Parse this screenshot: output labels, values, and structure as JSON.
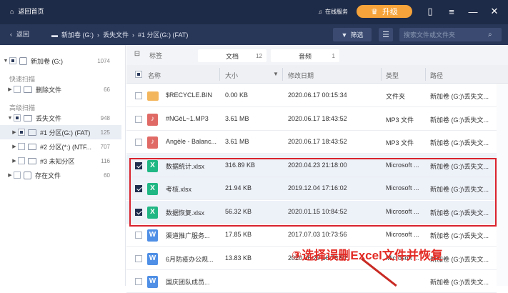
{
  "titlebar": {
    "home_label": "返回首页",
    "online_label": "在线服务",
    "upgrade_label": "升级"
  },
  "navbar": {
    "back_label": "返回",
    "breadcrumb": [
      "新加卷 (G:)",
      "丢失文件",
      "#1 分区(G:) (FAT)"
    ],
    "filter_label": "筛选",
    "search_placeholder": "搜索文件或文件夹"
  },
  "sidebar": {
    "root": {
      "label": "新加卷 (G:)",
      "count": "1074"
    },
    "quick_scan_label": "快速扫描",
    "deleted": {
      "label": "删除文件",
      "count": "66"
    },
    "adv_scan_label": "高级扫描",
    "lost": {
      "label": "丢失文件",
      "count": "948"
    },
    "partitions": [
      {
        "label": "#1 分区(G:) (FAT)",
        "count": "125"
      },
      {
        "label": "#2 分区(*:) (NTF...",
        "count": "707"
      },
      {
        "label": "#3 未知分区",
        "count": "116"
      }
    ],
    "existing": {
      "label": "存在文件",
      "count": "60"
    }
  },
  "tabs": {
    "tag_label": "标签",
    "items": [
      {
        "label": "文档",
        "count": "12"
      },
      {
        "label": "音频",
        "count": "1"
      }
    ]
  },
  "columns": {
    "name": "名称",
    "size": "大小",
    "date": "修改日期",
    "type": "类型",
    "path": "路径"
  },
  "rows": [
    {
      "icon": "folder",
      "name": "$RECYCLE.BIN",
      "size": "0.00 KB",
      "date": "2020.06.17 00:15:34",
      "type": "文件夹",
      "path": "新加卷 (G:)\\丢失文...",
      "checked": false
    },
    {
      "icon": "mp3",
      "name": "#NGèL~1.MP3",
      "size": "3.61 MB",
      "date": "2020.06.17 18:43:52",
      "type": "MP3 文件",
      "path": "新加卷 (G:)\\丢失文...",
      "checked": false
    },
    {
      "icon": "mp3",
      "name": "Angèle - Balanc...",
      "size": "3.61 MB",
      "date": "2020.06.17 18:43:52",
      "type": "MP3 文件",
      "path": "新加卷 (G:)\\丢失文...",
      "checked": false
    },
    {
      "icon": "xls",
      "name": "数据统计.xlsx",
      "size": "316.89 KB",
      "date": "2020.04.23 21:18:00",
      "type": "Microsoft ...",
      "path": "新加卷 (G:)\\丢失文...",
      "checked": true
    },
    {
      "icon": "xls",
      "name": "考核.xlsx",
      "size": "21.94 KB",
      "date": "2019.12.04 17:16:02",
      "type": "Microsoft ...",
      "path": "新加卷 (G:)\\丢失文...",
      "checked": true
    },
    {
      "icon": "xls",
      "name": "数据恢复.xlsx",
      "size": "56.32 KB",
      "date": "2020.01.15 10:84:52",
      "type": "Microsoft ...",
      "path": "新加卷 (G:)\\丢失文...",
      "checked": true
    },
    {
      "icon": "doc",
      "name": "渠道推广服务...",
      "size": "17.85 KB",
      "date": "2017.07.03 10:73:56",
      "type": "Microsoft ...",
      "path": "新加卷 (G:)\\丢失文...",
      "checked": false
    },
    {
      "icon": "doc",
      "name": "6月防疫办公规...",
      "size": "13.83 KB",
      "date": "2020.06.29 16:78:52",
      "type": "Microsoft ...",
      "path": "新加卷 (G:)\\丢失文...",
      "checked": false
    },
    {
      "icon": "doc",
      "name": "国庆团队成员...",
      "size": "",
      "date": "",
      "type": "",
      "path": "新加卷 (G:)\\丢失文...",
      "checked": false
    }
  ],
  "annotation": "③选择误删Excel文件并恢复",
  "colors": {
    "titlebar": "#1e2b48",
    "accent_orange": "#f5a33a",
    "highlight_red": "#d9232d"
  }
}
